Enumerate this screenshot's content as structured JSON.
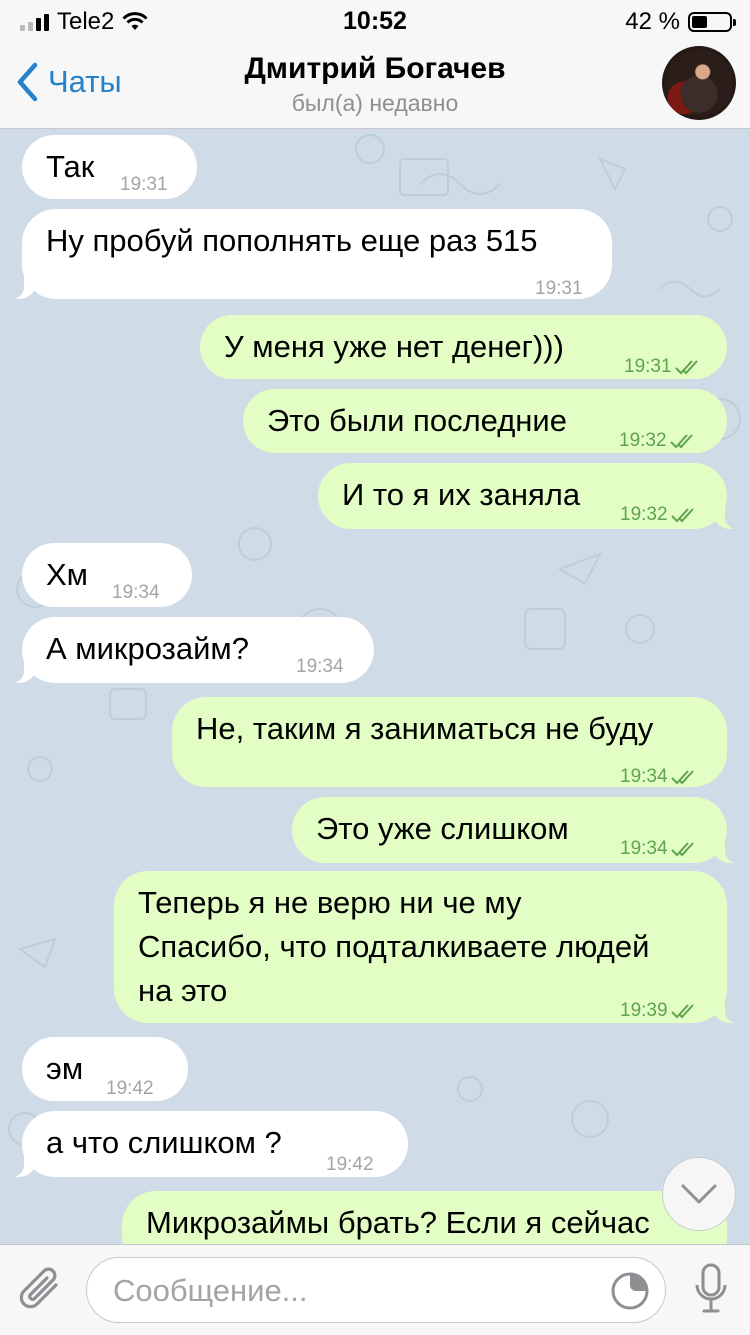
{
  "status_bar": {
    "carrier": "Tele2",
    "time": "10:52",
    "battery": "42 %",
    "battery_level": 0.42
  },
  "header": {
    "back_label": "Чаты",
    "contact_name": "Дмитрий Богачев",
    "last_seen": "был(а) недавно"
  },
  "messages": [
    {
      "dir": "in",
      "text": "Так",
      "time": "19:31"
    },
    {
      "dir": "in",
      "text": "Ну пробуй пополнять еще раз 515",
      "time": "19:31"
    },
    {
      "dir": "out",
      "text": "У меня уже нет денег)))",
      "time": "19:31"
    },
    {
      "dir": "out",
      "text": "Это были последние",
      "time": "19:32"
    },
    {
      "dir": "out",
      "text": "И то я их заняла",
      "time": "19:32"
    },
    {
      "dir": "in",
      "text": "Хм",
      "time": "19:34"
    },
    {
      "dir": "in",
      "text": "А микрозайм?",
      "time": "19:34"
    },
    {
      "dir": "out",
      "text": "Не, таким я заниматься не буду",
      "time": "19:34"
    },
    {
      "dir": "out",
      "text": "Это уже слишком",
      "time": "19:34"
    },
    {
      "dir": "out",
      "text": "Теперь я не верю ни че му\nСпасибо, что подталкиваете людей\nна это",
      "time": "19:39"
    },
    {
      "dir": "in",
      "text": "эм",
      "time": "19:42"
    },
    {
      "dir": "in",
      "text": "а что слишком ?",
      "time": "19:42"
    },
    {
      "dir": "out",
      "text": "Микрозаймы брать? Если я сейчас",
      "time": ""
    }
  ],
  "input": {
    "placeholder": "Сообщение..."
  },
  "colors": {
    "accent": "#2481cc",
    "incoming_bubble": "#ffffff",
    "outgoing_bubble": "#e2fec5",
    "outgoing_time": "#5fa44d",
    "chat_background": "#cfdbe6"
  },
  "icons": {
    "back": "chevron-left-icon",
    "attach": "paperclip-icon",
    "sticker": "sticker-icon",
    "mic": "microphone-icon",
    "scroll_down": "chevron-down-icon",
    "read": "double-check-icon"
  }
}
